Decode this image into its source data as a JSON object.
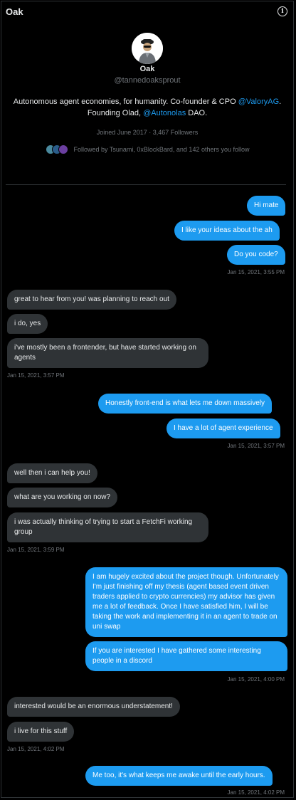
{
  "header": {
    "title": "Oak"
  },
  "profile": {
    "name": "Oak",
    "handle": "@tannedoaksprout",
    "bio_part1": "Autonomous agent economies, for humanity. Co-founder & CPO ",
    "bio_link1": "@ValoryAG",
    "bio_part2": ". Founding Olad, ",
    "bio_link2": "@Autonolas",
    "bio_part3": " DAO.",
    "joined": "Joined June 2017 · 3,467 Followers",
    "followed_by": "Followed by Tsunami, 0xBlockBard, and 142 others you follow"
  },
  "messages": [
    {
      "dir": "out",
      "text": "Hi mate"
    },
    {
      "dir": "out",
      "text": "I like your ideas about the ah"
    },
    {
      "dir": "out",
      "text": "Do you code?"
    },
    {
      "dir": "ts",
      "text": "Jan 15, 2021, 3:55 PM"
    },
    {
      "dir": "in",
      "text": "great to hear from you! was planning to reach out"
    },
    {
      "dir": "in",
      "text": "i do, yes"
    },
    {
      "dir": "in",
      "text": "i've mostly been a frontender, but have started working on agents"
    },
    {
      "dir": "ts",
      "text": "Jan 15, 2021, 3:57 PM"
    },
    {
      "dir": "out",
      "text": "Honestly front-end is what lets me down massively"
    },
    {
      "dir": "out",
      "text": "I have a lot of agent experience"
    },
    {
      "dir": "ts",
      "text": "Jan 15, 2021, 3:57 PM"
    },
    {
      "dir": "in",
      "text": "well then i can help you!"
    },
    {
      "dir": "in",
      "text": "what are you working on now?"
    },
    {
      "dir": "in",
      "text": "i was actually thinking of trying to start a FetchFi working group"
    },
    {
      "dir": "ts",
      "text": "Jan 15, 2021, 3:59 PM"
    },
    {
      "dir": "out",
      "text": "I am hugely excited about the project though. Unfortunately I'm just finishing off my thesis (agent based event driven traders applied to crypto currencies) my advisor has given me a lot of feedback. Once I have satisfied him,  I will be taking the work and implementing it in an agent to trade on uni swap"
    },
    {
      "dir": "out",
      "text": "If you are interested I have gathered some interesting people in a discord"
    },
    {
      "dir": "ts",
      "text": "Jan 15, 2021, 4:00 PM"
    },
    {
      "dir": "in",
      "text": "interested would be an enormous understatement!"
    },
    {
      "dir": "in",
      "text": "i live for this stuff"
    },
    {
      "dir": "ts",
      "text": "Jan 15, 2021, 4:02 PM"
    },
    {
      "dir": "out",
      "text": "Me too, it's what keeps me awake until the early hours."
    },
    {
      "dir": "ts",
      "text": "Jan 15, 2021, 4:02 PM"
    }
  ],
  "colors": {
    "accent": "#1d9bf0",
    "incoming_bubble": "#2f3336",
    "background": "#000000",
    "muted_text": "#71767b"
  },
  "icons": {
    "info": "info-icon",
    "avatar": "avatar-image"
  }
}
